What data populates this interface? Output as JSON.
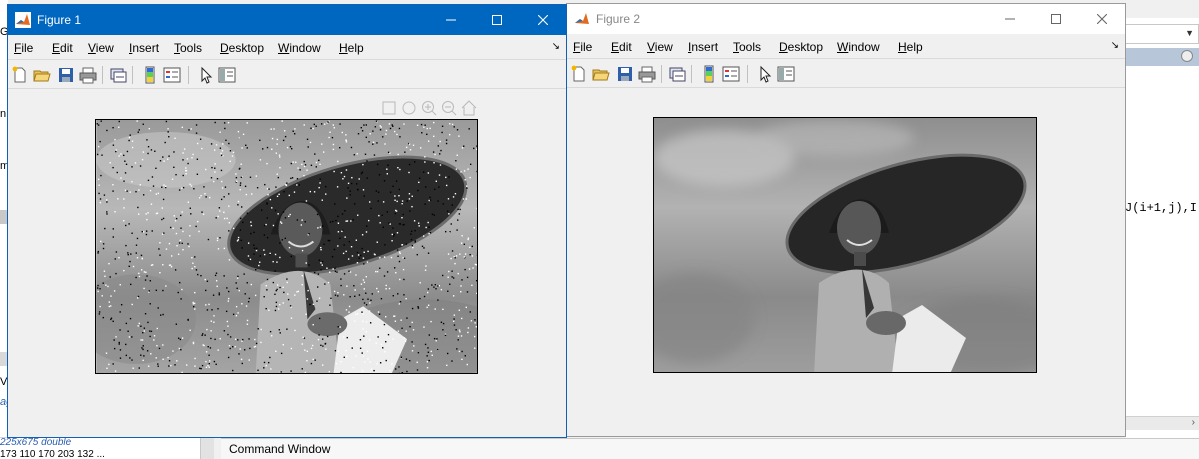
{
  "background": {
    "left_fragments": [
      "G:",
      "n",
      "m",
      "Va",
      "ag"
    ],
    "workspace_type": "225x675 double",
    "workspace_values": "173 110 170 203 132 ...",
    "command_window_title": "Command Window",
    "editor_code_fragment": "J(i+1,j),I"
  },
  "figure1": {
    "title": "Figure 1",
    "menu": [
      "File",
      "Edit",
      "View",
      "Insert",
      "Tools",
      "Desktop",
      "Window",
      "Help"
    ],
    "menu_underline": [
      "F",
      "E",
      "V",
      "I",
      "T",
      "D",
      "W",
      "H"
    ],
    "image_description_name": "noisy-grayscale-image",
    "titlebar_color": "#0067c0"
  },
  "figure2": {
    "title": "Figure 2",
    "menu": [
      "File",
      "Edit",
      "View",
      "Insert",
      "Tools",
      "Desktop",
      "Window",
      "Help"
    ],
    "menu_underline": [
      "F",
      "E",
      "V",
      "I",
      "T",
      "D",
      "W",
      "H"
    ],
    "image_description_name": "filtered-grayscale-image"
  },
  "toolbar_icons": [
    "new-figure-icon",
    "open-file-icon",
    "save-icon",
    "print-icon",
    "link-plot-icon",
    "insert-colorbar-icon",
    "insert-legend-icon",
    "edit-plot-icon",
    "show-plot-tools-icon"
  ],
  "axes_toolbar_icons": [
    "brush-icon",
    "pan-icon",
    "zoom-in-icon",
    "zoom-out-icon",
    "home-icon"
  ]
}
